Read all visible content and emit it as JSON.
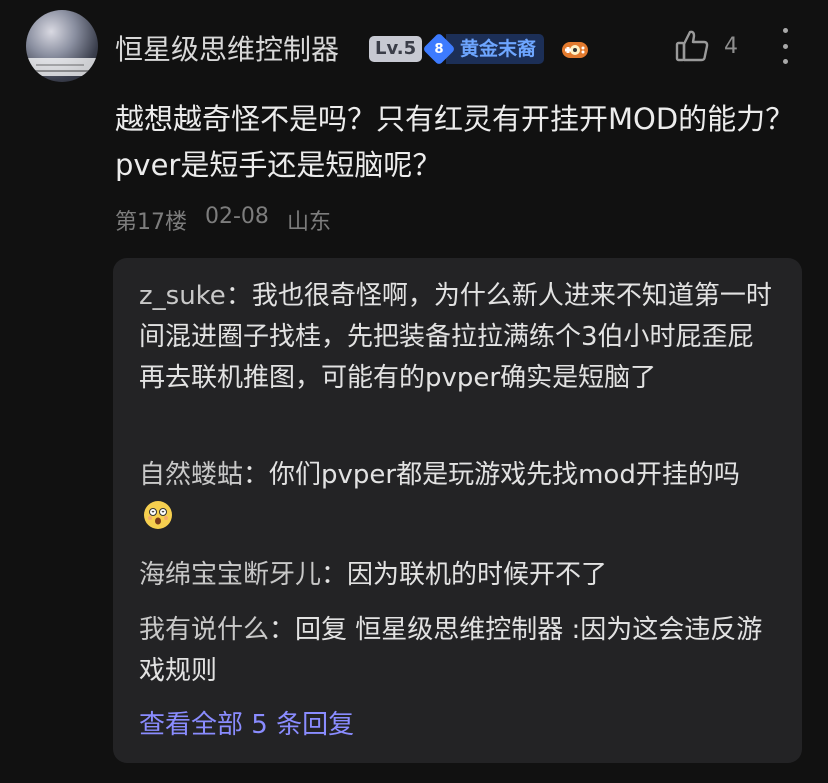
{
  "comment": {
    "username": "恒星级思维控制器",
    "level_badge": "Lv.5",
    "fan_level": "8",
    "fan_title": "黄金末裔",
    "like_count": "4",
    "text": "越想越奇怪不是吗？只有红灵有开挂开MOD的能力？pver是短手还是短脑呢？",
    "floor": "第17楼",
    "date": "02-08",
    "location": "山东"
  },
  "replies": [
    {
      "author": "z_suke",
      "text": "：我也很奇怪啊，为什么新人进来不知道第一时间混进圈子找桂，先把装备拉拉满练个3伯小时屁歪屁再去联机推图，可能有的pvper确实是短脑了"
    },
    {
      "author": "自然蝼蛄",
      "text": "：你们pvper都是玩游戏先找mod开挂的吗"
    },
    {
      "author": "海绵宝宝断牙儿",
      "text": "：因为联机的时候开不了"
    },
    {
      "author": "我有说什么",
      "text": "：回复 恒星级思维控制器 :因为这会违反游戏规则"
    }
  ],
  "view_all": "查看全部 5 条回复",
  "icons": {
    "like": "thumbs-up-icon",
    "more": "more-vertical-icon",
    "game": "gamepad-icon",
    "emoji": "dizzy-face-emoji"
  },
  "colors": {
    "background": "#111111",
    "reply_panel": "#232325",
    "link": "#8a8cff",
    "fan_badge": "#3d7bff"
  }
}
